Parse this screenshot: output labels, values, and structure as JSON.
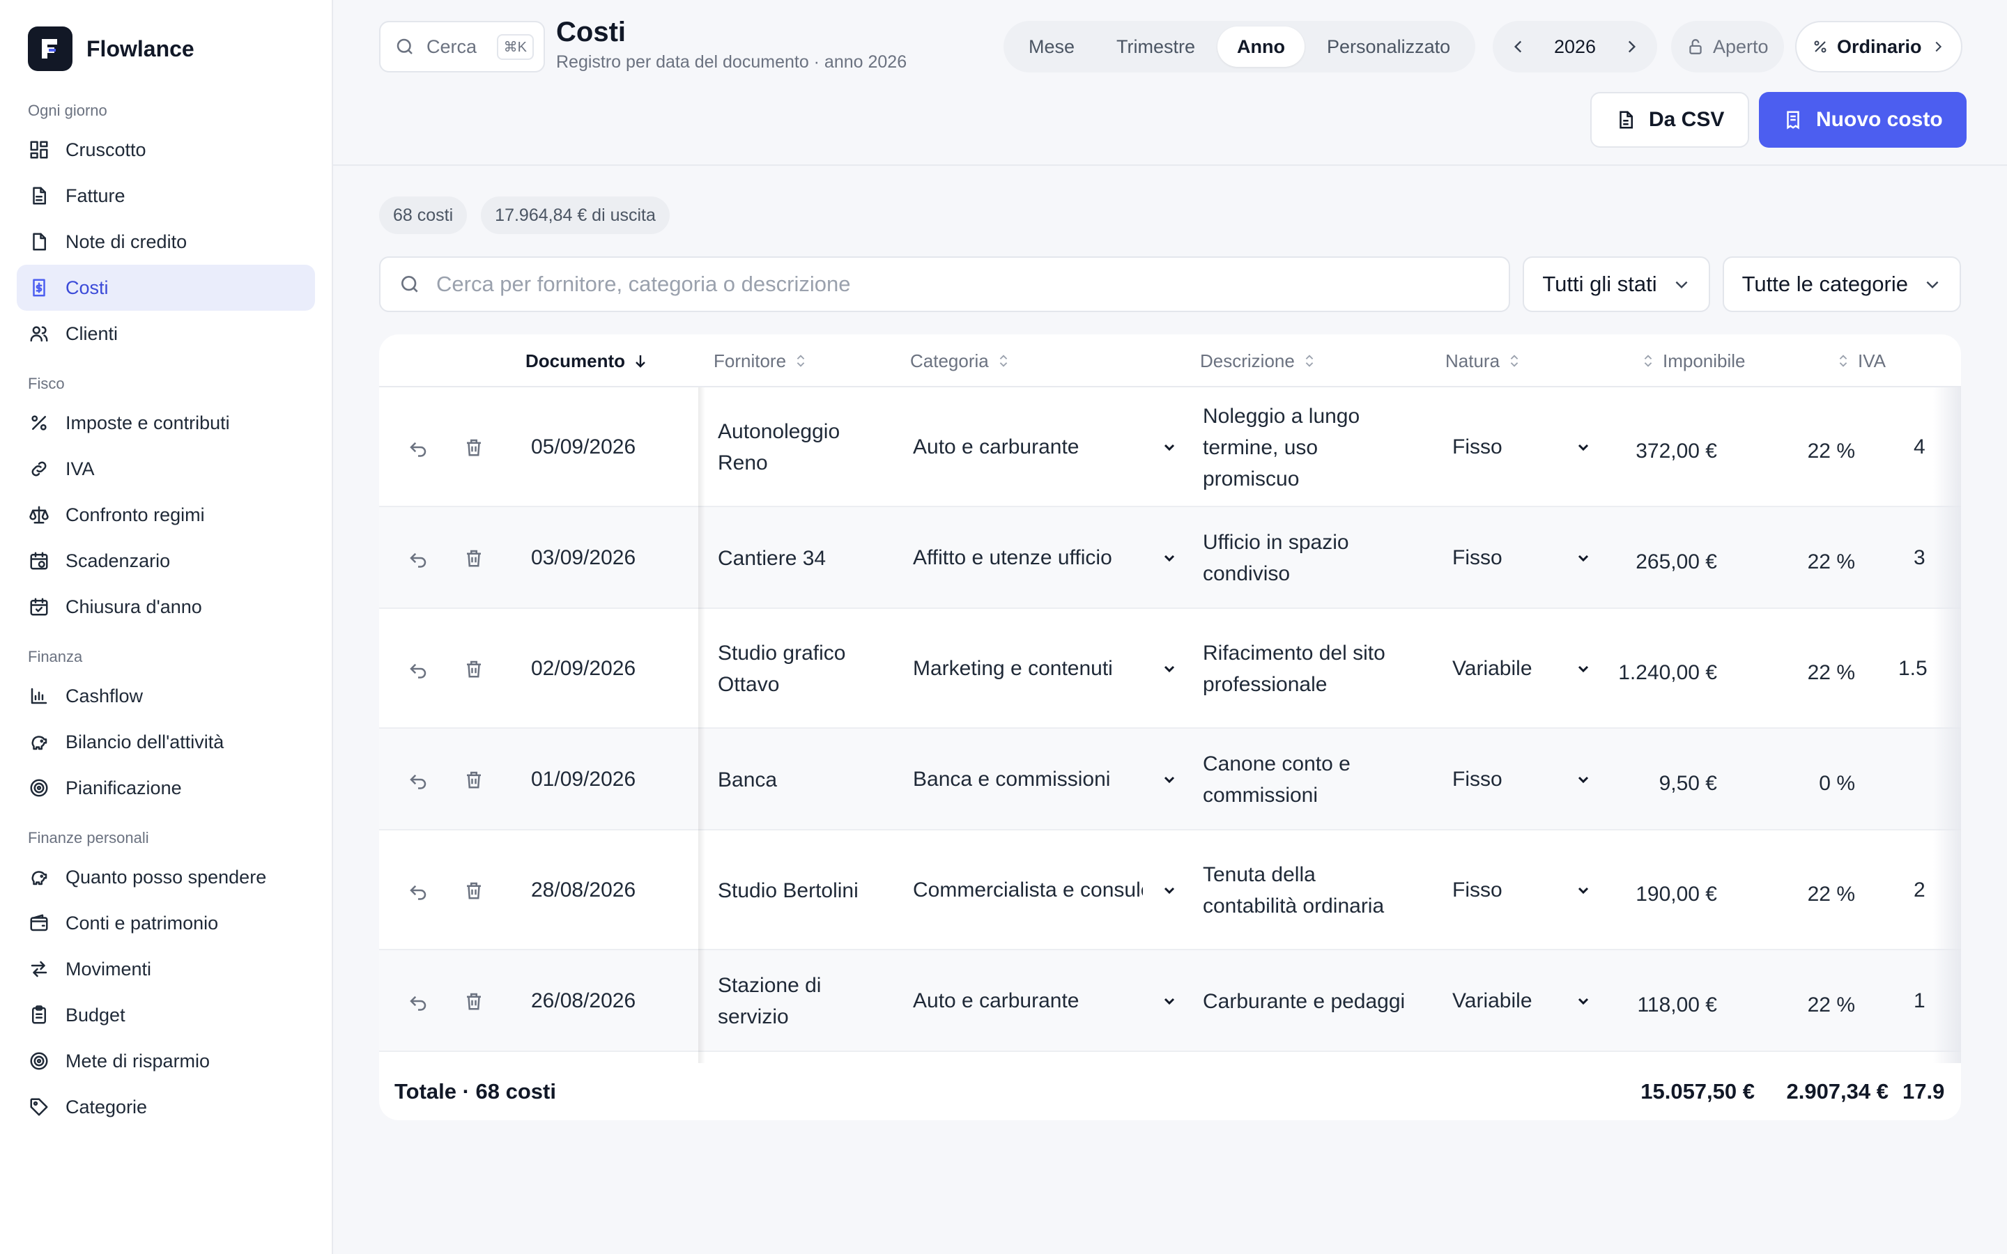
{
  "app": {
    "name": "Flowlance"
  },
  "sidebar": {
    "sections": [
      {
        "title": "Ogni giorno",
        "items": [
          {
            "label": "Cruscotto",
            "icon": "dashboard-icon",
            "active": false
          },
          {
            "label": "Fatture",
            "icon": "invoice-icon",
            "active": false
          },
          {
            "label": "Note di credito",
            "icon": "credit-note-icon",
            "active": false
          },
          {
            "label": "Costi",
            "icon": "costs-icon",
            "active": true
          },
          {
            "label": "Clienti",
            "icon": "clients-icon",
            "active": false
          }
        ]
      },
      {
        "title": "Fisco",
        "items": [
          {
            "label": "Imposte e contributi",
            "icon": "percent-icon",
            "active": false
          },
          {
            "label": "IVA",
            "icon": "link-icon",
            "active": false
          },
          {
            "label": "Confronto regimi",
            "icon": "scale-icon",
            "active": false
          },
          {
            "label": "Scadenzario",
            "icon": "calendar-clock-icon",
            "active": false
          },
          {
            "label": "Chiusura d'anno",
            "icon": "calendar-check-icon",
            "active": false
          }
        ]
      },
      {
        "title": "Finanza",
        "items": [
          {
            "label": "Cashflow",
            "icon": "bar-chart-icon",
            "active": false
          },
          {
            "label": "Bilancio dell'attività",
            "icon": "piggy-bank-icon",
            "active": false
          },
          {
            "label": "Pianificazione",
            "icon": "target-icon",
            "active": false
          }
        ]
      },
      {
        "title": "Finanze personali",
        "items": [
          {
            "label": "Quanto posso spendere",
            "icon": "piggy-bank-icon",
            "active": false
          },
          {
            "label": "Conti e patrimonio",
            "icon": "wallet-icon",
            "active": false
          },
          {
            "label": "Movimenti",
            "icon": "arrows-icon",
            "active": false
          },
          {
            "label": "Budget",
            "icon": "clipboard-icon",
            "active": false
          },
          {
            "label": "Mete di risparmio",
            "icon": "target-icon",
            "active": false
          },
          {
            "label": "Categorie",
            "icon": "tag-icon",
            "active": false
          }
        ]
      }
    ]
  },
  "header": {
    "search_label": "Cerca",
    "search_shortcut": "⌘K",
    "title": "Costi",
    "subtitle": "Registro per data del documento · anno 2026",
    "periods": [
      "Mese",
      "Trimestre",
      "Anno",
      "Personalizzato"
    ],
    "active_period": "Anno",
    "year": "2026",
    "status_label": "Aperto",
    "regime_label": "Ordinario",
    "csv_button": "Da CSV",
    "new_button": "Nuovo costo"
  },
  "summary": {
    "count_label": "68 costi",
    "total_label": "17.964,84 € di uscita"
  },
  "filters": {
    "search_placeholder": "Cerca per fornitore, categoria o descrizione",
    "status_select": "Tutti gli stati",
    "category_select": "Tutte le categorie"
  },
  "table": {
    "columns": {
      "document": "Documento",
      "supplier": "Fornitore",
      "category": "Categoria",
      "description": "Descrizione",
      "nature": "Natura",
      "taxable": "Imponibile",
      "vat": "IVA"
    },
    "rows": [
      {
        "date": "05/09/2026",
        "supplier": "Autonoleggio Reno",
        "category": "Auto e carburante",
        "description": "Noleggio a lungo termine, uso promiscuo",
        "nature": "Fisso",
        "taxable": "372,00 €",
        "vat": "22 %",
        "total_partial": "4"
      },
      {
        "date": "03/09/2026",
        "supplier": "Cantiere 34",
        "category": "Affitto e utenze ufficio",
        "description": "Ufficio in spazio condiviso",
        "nature": "Fisso",
        "taxable": "265,00 €",
        "vat": "22 %",
        "total_partial": "3"
      },
      {
        "date": "02/09/2026",
        "supplier": "Studio grafico Ottavo",
        "category": "Marketing e contenuti",
        "description": "Rifacimento del sito professionale",
        "nature": "Variabile",
        "taxable": "1.240,00 €",
        "vat": "22 %",
        "total_partial": "1.5"
      },
      {
        "date": "01/09/2026",
        "supplier": "Banca",
        "category": "Banca e commissioni",
        "description": "Canone conto e commissioni",
        "nature": "Fisso",
        "taxable": "9,50 €",
        "vat": "0 %",
        "total_partial": ""
      },
      {
        "date": "28/08/2026",
        "supplier": "Studio Bertolini",
        "category": "Commercialista e consulenze",
        "description": "Tenuta della contabilità ordinaria",
        "nature": "Fisso",
        "taxable": "190,00 €",
        "vat": "22 %",
        "total_partial": "2"
      },
      {
        "date": "26/08/2026",
        "supplier": "Stazione di servizio",
        "category": "Auto e carburante",
        "description": "Carburante e pedaggi",
        "nature": "Variabile",
        "taxable": "118,00 €",
        "vat": "22 %",
        "total_partial": "1"
      }
    ],
    "footer": {
      "label": "Totale · 68 costi",
      "taxable_total": "15.057,50 €",
      "vat_total": "2.907,34 €",
      "grand_total_partial": "17.9"
    }
  },
  "colors": {
    "accent": "#4c5ef0",
    "active_nav_bg": "#eaedfb"
  }
}
